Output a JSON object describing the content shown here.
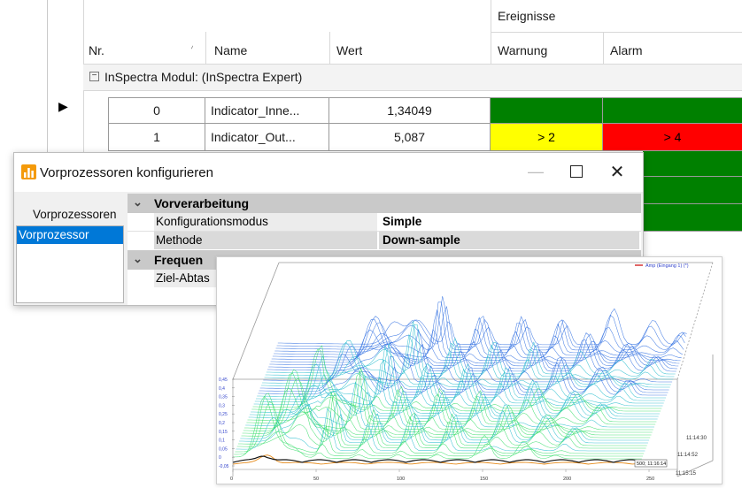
{
  "grid": {
    "group_header": "Ereignisse",
    "columns": {
      "nr": "Nr.",
      "name": "Name",
      "wert": "Wert",
      "warnung": "Warnung",
      "alarm": "Alarm"
    },
    "group_row": "InSpectra Modul:  (InSpectra Expert)",
    "rows": [
      {
        "nr": "0",
        "name": "Indicator_Inne...",
        "wert": "1,34049",
        "warnung": "",
        "alarm": ""
      },
      {
        "nr": "1",
        "name": "Indicator_Out...",
        "wert": "5,087",
        "warnung": "> 2",
        "alarm": "> 4"
      }
    ],
    "colors": {
      "green": "#008000",
      "yellow": "#ffff00",
      "red": "#ff0000"
    }
  },
  "dialog": {
    "title": "Vorprozessoren konfigurieren",
    "left_label": "Vorprozessoren",
    "left_items": [
      "Vorprozessor"
    ],
    "categories": [
      {
        "name": "Vorverarbeitung",
        "props": [
          {
            "name": "Konfigurationsmodus",
            "value": "Simple"
          },
          {
            "name": "Methode",
            "value": "Down-sample"
          }
        ]
      },
      {
        "name": "Frequen",
        "props": [
          {
            "name": "Ziel-Abtas",
            "value": ""
          }
        ]
      }
    ],
    "accent": "#f49a0a"
  },
  "chart": {
    "legend": "Amp (Eingang 1) (*)",
    "y_ticks": [
      "0,45",
      "0,4",
      "0,35",
      "0,3",
      "0,25",
      "0,2",
      "0,15",
      "0,1",
      "0,05",
      "0",
      "-0,05"
    ],
    "x_ticks": [
      "0",
      "50",
      "100",
      "150",
      "200",
      "250"
    ],
    "time_labels": [
      "11:14:30",
      "11:14:52",
      "11:15:15"
    ],
    "cursor_label": "500; 11:16:14"
  }
}
